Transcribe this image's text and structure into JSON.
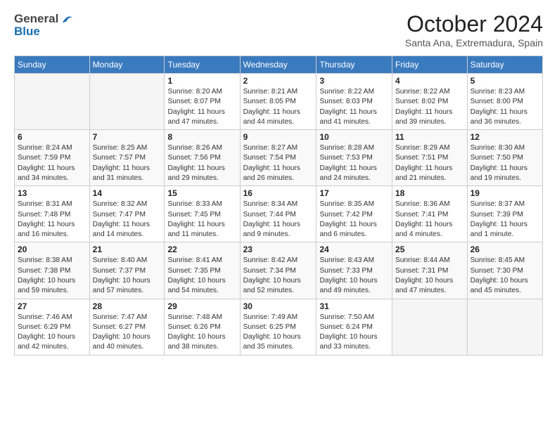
{
  "header": {
    "logo_line1": "General",
    "logo_line2": "Blue",
    "month_title": "October 2024",
    "subtitle": "Santa Ana, Extremadura, Spain"
  },
  "weekdays": [
    "Sunday",
    "Monday",
    "Tuesday",
    "Wednesday",
    "Thursday",
    "Friday",
    "Saturday"
  ],
  "weeks": [
    [
      {
        "day": "",
        "empty": true
      },
      {
        "day": "",
        "empty": true
      },
      {
        "day": "1",
        "sunrise": "Sunrise: 8:20 AM",
        "sunset": "Sunset: 8:07 PM",
        "daylight": "Daylight: 11 hours and 47 minutes."
      },
      {
        "day": "2",
        "sunrise": "Sunrise: 8:21 AM",
        "sunset": "Sunset: 8:05 PM",
        "daylight": "Daylight: 11 hours and 44 minutes."
      },
      {
        "day": "3",
        "sunrise": "Sunrise: 8:22 AM",
        "sunset": "Sunset: 8:03 PM",
        "daylight": "Daylight: 11 hours and 41 minutes."
      },
      {
        "day": "4",
        "sunrise": "Sunrise: 8:22 AM",
        "sunset": "Sunset: 8:02 PM",
        "daylight": "Daylight: 11 hours and 39 minutes."
      },
      {
        "day": "5",
        "sunrise": "Sunrise: 8:23 AM",
        "sunset": "Sunset: 8:00 PM",
        "daylight": "Daylight: 11 hours and 36 minutes."
      }
    ],
    [
      {
        "day": "6",
        "sunrise": "Sunrise: 8:24 AM",
        "sunset": "Sunset: 7:59 PM",
        "daylight": "Daylight: 11 hours and 34 minutes."
      },
      {
        "day": "7",
        "sunrise": "Sunrise: 8:25 AM",
        "sunset": "Sunset: 7:57 PM",
        "daylight": "Daylight: 11 hours and 31 minutes."
      },
      {
        "day": "8",
        "sunrise": "Sunrise: 8:26 AM",
        "sunset": "Sunset: 7:56 PM",
        "daylight": "Daylight: 11 hours and 29 minutes."
      },
      {
        "day": "9",
        "sunrise": "Sunrise: 8:27 AM",
        "sunset": "Sunset: 7:54 PM",
        "daylight": "Daylight: 11 hours and 26 minutes."
      },
      {
        "day": "10",
        "sunrise": "Sunrise: 8:28 AM",
        "sunset": "Sunset: 7:53 PM",
        "daylight": "Daylight: 11 hours and 24 minutes."
      },
      {
        "day": "11",
        "sunrise": "Sunrise: 8:29 AM",
        "sunset": "Sunset: 7:51 PM",
        "daylight": "Daylight: 11 hours and 21 minutes."
      },
      {
        "day": "12",
        "sunrise": "Sunrise: 8:30 AM",
        "sunset": "Sunset: 7:50 PM",
        "daylight": "Daylight: 11 hours and 19 minutes."
      }
    ],
    [
      {
        "day": "13",
        "sunrise": "Sunrise: 8:31 AM",
        "sunset": "Sunset: 7:48 PM",
        "daylight": "Daylight: 11 hours and 16 minutes."
      },
      {
        "day": "14",
        "sunrise": "Sunrise: 8:32 AM",
        "sunset": "Sunset: 7:47 PM",
        "daylight": "Daylight: 11 hours and 14 minutes."
      },
      {
        "day": "15",
        "sunrise": "Sunrise: 8:33 AM",
        "sunset": "Sunset: 7:45 PM",
        "daylight": "Daylight: 11 hours and 11 minutes."
      },
      {
        "day": "16",
        "sunrise": "Sunrise: 8:34 AM",
        "sunset": "Sunset: 7:44 PM",
        "daylight": "Daylight: 11 hours and 9 minutes."
      },
      {
        "day": "17",
        "sunrise": "Sunrise: 8:35 AM",
        "sunset": "Sunset: 7:42 PM",
        "daylight": "Daylight: 11 hours and 6 minutes."
      },
      {
        "day": "18",
        "sunrise": "Sunrise: 8:36 AM",
        "sunset": "Sunset: 7:41 PM",
        "daylight": "Daylight: 11 hours and 4 minutes."
      },
      {
        "day": "19",
        "sunrise": "Sunrise: 8:37 AM",
        "sunset": "Sunset: 7:39 PM",
        "daylight": "Daylight: 11 hours and 1 minute."
      }
    ],
    [
      {
        "day": "20",
        "sunrise": "Sunrise: 8:38 AM",
        "sunset": "Sunset: 7:38 PM",
        "daylight": "Daylight: 10 hours and 59 minutes."
      },
      {
        "day": "21",
        "sunrise": "Sunrise: 8:40 AM",
        "sunset": "Sunset: 7:37 PM",
        "daylight": "Daylight: 10 hours and 57 minutes."
      },
      {
        "day": "22",
        "sunrise": "Sunrise: 8:41 AM",
        "sunset": "Sunset: 7:35 PM",
        "daylight": "Daylight: 10 hours and 54 minutes."
      },
      {
        "day": "23",
        "sunrise": "Sunrise: 8:42 AM",
        "sunset": "Sunset: 7:34 PM",
        "daylight": "Daylight: 10 hours and 52 minutes."
      },
      {
        "day": "24",
        "sunrise": "Sunrise: 8:43 AM",
        "sunset": "Sunset: 7:33 PM",
        "daylight": "Daylight: 10 hours and 49 minutes."
      },
      {
        "day": "25",
        "sunrise": "Sunrise: 8:44 AM",
        "sunset": "Sunset: 7:31 PM",
        "daylight": "Daylight: 10 hours and 47 minutes."
      },
      {
        "day": "26",
        "sunrise": "Sunrise: 8:45 AM",
        "sunset": "Sunset: 7:30 PM",
        "daylight": "Daylight: 10 hours and 45 minutes."
      }
    ],
    [
      {
        "day": "27",
        "sunrise": "Sunrise: 7:46 AM",
        "sunset": "Sunset: 6:29 PM",
        "daylight": "Daylight: 10 hours and 42 minutes."
      },
      {
        "day": "28",
        "sunrise": "Sunrise: 7:47 AM",
        "sunset": "Sunset: 6:27 PM",
        "daylight": "Daylight: 10 hours and 40 minutes."
      },
      {
        "day": "29",
        "sunrise": "Sunrise: 7:48 AM",
        "sunset": "Sunset: 6:26 PM",
        "daylight": "Daylight: 10 hours and 38 minutes."
      },
      {
        "day": "30",
        "sunrise": "Sunrise: 7:49 AM",
        "sunset": "Sunset: 6:25 PM",
        "daylight": "Daylight: 10 hours and 35 minutes."
      },
      {
        "day": "31",
        "sunrise": "Sunrise: 7:50 AM",
        "sunset": "Sunset: 6:24 PM",
        "daylight": "Daylight: 10 hours and 33 minutes."
      },
      {
        "day": "",
        "empty": true
      },
      {
        "day": "",
        "empty": true
      }
    ]
  ]
}
